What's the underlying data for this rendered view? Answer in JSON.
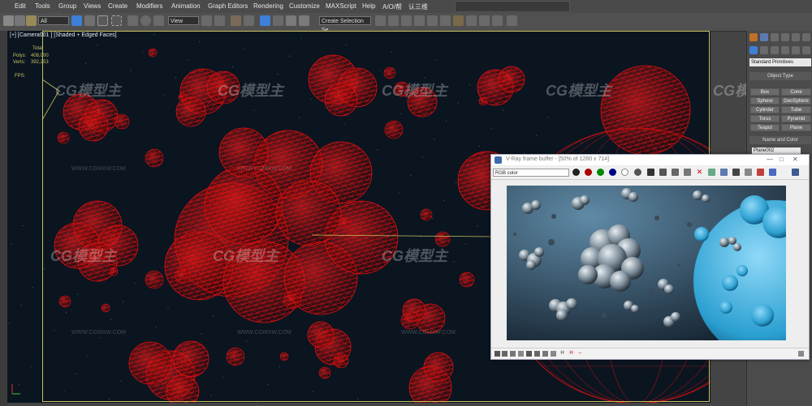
{
  "menu": {
    "items": [
      "Edit",
      "Tools",
      "Group",
      "Views",
      "Create",
      "Modifiers",
      "Animation",
      "Graph Editors",
      "Rendering",
      "Customize",
      "MAXScript",
      "Help",
      "A/O/帮",
      "认三维"
    ]
  },
  "toolbar": {
    "selection_filter": "All",
    "reference_coord": "View",
    "named_selection": "Create Selection Se",
    "colors": {
      "active": "#3e7fd8",
      "red": "#d03030",
      "green": "#3a9a3a"
    }
  },
  "viewport": {
    "label": "[+] [Camera001 ] [Shaded + Edged Faces]",
    "stats": {
      "total_label": "Total",
      "polys_label": "Polys:",
      "polys_value": "408,000",
      "verts_label": "Verts:",
      "verts_value": "392,253",
      "fps_label": "FPS:"
    },
    "wireframe_color": "#e01010",
    "background_color": "#0a1520"
  },
  "command_panel": {
    "dropdown": "Standard Primitives",
    "object_type_header": "Object Type",
    "object_buttons": [
      "Box",
      "Cone",
      "Sphere",
      "GeoSphere",
      "Cylinder",
      "Tube",
      "Torus",
      "Pyramid",
      "Teapot",
      "Plane"
    ],
    "name_color_header": "Name and Color",
    "object_name": "Plane002"
  },
  "vfb": {
    "title": "V-Ray frame buffer - [50% of 1280 x 714]",
    "channel": "RGB color",
    "controls": {
      "minimize": "—",
      "maximize": "□",
      "close": "✕"
    }
  },
  "watermarks": {
    "brand": "CG模型主",
    "url": "WWW.CGMXW.COM"
  }
}
